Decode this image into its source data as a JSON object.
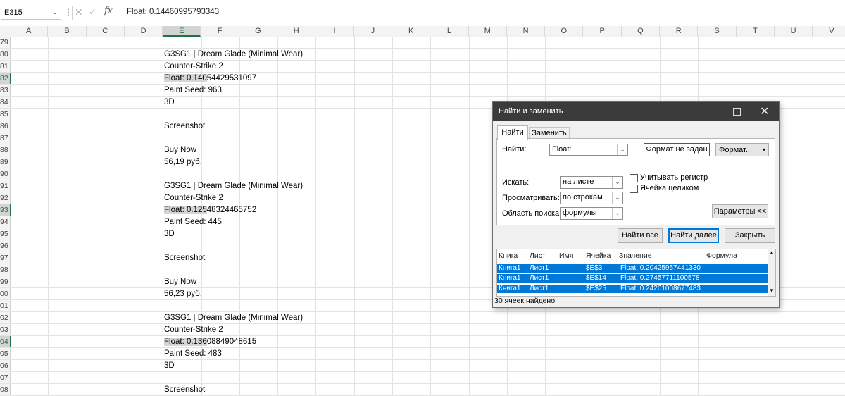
{
  "formula_bar": {
    "name_box": "E315",
    "dropdown_glyph": "⌄",
    "more_glyph": "⋮",
    "cancel_glyph": "✕",
    "enter_glyph": "✓",
    "fx_label": "fx",
    "content": "Float: 0.14460995793343"
  },
  "columns": [
    "A",
    "B",
    "C",
    "D",
    "E",
    "F",
    "G",
    "H",
    "I",
    "J",
    "K",
    "L",
    "M",
    "N",
    "O",
    "P",
    "Q",
    "R",
    "S",
    "T",
    "U",
    "V"
  ],
  "selected_column": "E",
  "rows": [
    {
      "num": "79",
      "text": ""
    },
    {
      "num": "80",
      "text": "G3SG1 | Dream Glade (Minimal Wear)"
    },
    {
      "num": "81",
      "text": "Counter-Strike 2"
    },
    {
      "num": "82",
      "text": "Float: 0.14054429531097",
      "match": true
    },
    {
      "num": "83",
      "text": "Paint Seed: 963"
    },
    {
      "num": "84",
      "text": "3D"
    },
    {
      "num": "85",
      "text": ""
    },
    {
      "num": "86",
      "text": "Screenshot"
    },
    {
      "num": "87",
      "text": ""
    },
    {
      "num": "88",
      "text": "Buy Now"
    },
    {
      "num": "89",
      "text": "56,19 руб."
    },
    {
      "num": "90",
      "text": ""
    },
    {
      "num": "91",
      "text": "G3SG1 | Dream Glade (Minimal Wear)"
    },
    {
      "num": "92",
      "text": "Counter-Strike 2"
    },
    {
      "num": "93",
      "text": "Float: 0.12548324465752",
      "match": true
    },
    {
      "num": "94",
      "text": "Paint Seed: 445"
    },
    {
      "num": "95",
      "text": "3D"
    },
    {
      "num": "96",
      "text": ""
    },
    {
      "num": "97",
      "text": "Screenshot"
    },
    {
      "num": "98",
      "text": ""
    },
    {
      "num": "99",
      "text": "Buy Now"
    },
    {
      "num": "00",
      "text": "56,23 руб."
    },
    {
      "num": "01",
      "text": ""
    },
    {
      "num": "02",
      "text": "G3SG1 | Dream Glade (Minimal Wear)"
    },
    {
      "num": "03",
      "text": "Counter-Strike 2"
    },
    {
      "num": "04",
      "text": "Float: 0.13608849048615",
      "match": true
    },
    {
      "num": "05",
      "text": "Paint Seed: 483"
    },
    {
      "num": "06",
      "text": "3D"
    },
    {
      "num": "07",
      "text": ""
    },
    {
      "num": "08",
      "text": "Screenshot"
    }
  ],
  "dialog": {
    "title": "Найти и заменить",
    "minimize_glyph": "—",
    "close_glyph": "✕",
    "tabs": [
      "Найти",
      "Заменить"
    ],
    "find_label": "Найти:",
    "find_value": "Float:",
    "format_status": "Формат не задан",
    "format_button": "Формат...",
    "within_label": "Искать:",
    "within_value": "на листе",
    "search_label": "Просматривать:",
    "search_value": "по строкам",
    "lookin_label": "Область поиска:",
    "lookin_value": "формулы",
    "match_case": "Учитывать регистр",
    "match_entire": "Ячейка целиком",
    "options_button": "Параметры <<",
    "find_all_button": "Найти все",
    "find_next_button": "Найти далее",
    "close_button": "Закрыть",
    "results_headers": [
      "Книга",
      "Лист",
      "Имя",
      "Ячейка",
      "Значение",
      "Формула"
    ],
    "results": [
      {
        "book": "Книга1",
        "sheet": "Лист1",
        "name": "",
        "cell": "$E$3",
        "value": "Float: 0.20425957441330",
        "formula": ""
      },
      {
        "book": "Книга1",
        "sheet": "Лист1",
        "name": "",
        "cell": "$E$14",
        "value": "Float: 0.27457711100578",
        "formula": ""
      },
      {
        "book": "Книга1",
        "sheet": "Лист1",
        "name": "",
        "cell": "$E$25",
        "value": "Float: 0.24201008677483",
        "formula": ""
      }
    ],
    "status": "30 ячеек найдено"
  }
}
